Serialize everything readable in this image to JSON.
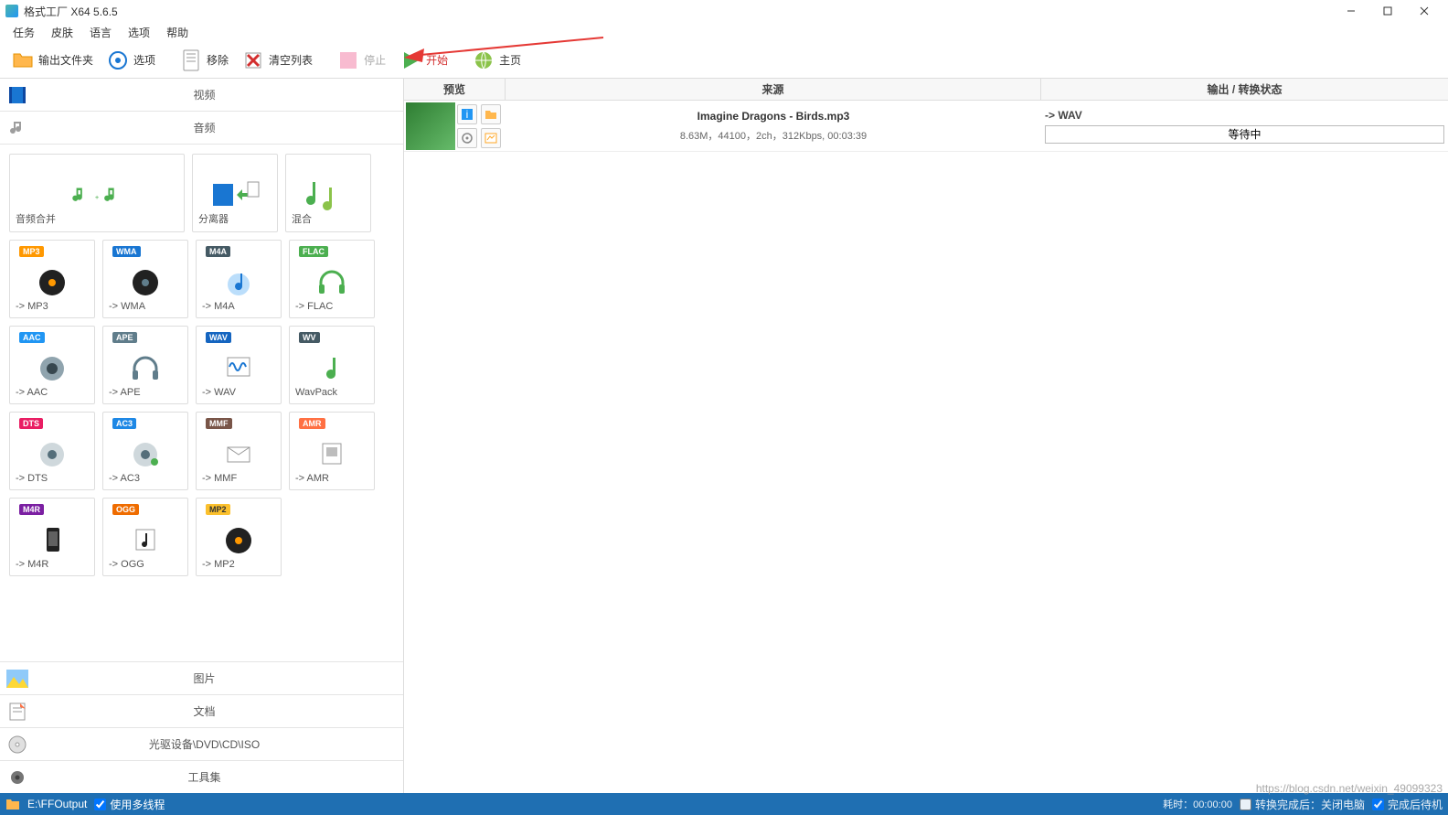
{
  "window": {
    "title": "格式工厂 X64 5.6.5"
  },
  "menu": {
    "tasks": "任务",
    "skin": "皮肤",
    "language": "语言",
    "options": "选项",
    "help": "帮助"
  },
  "toolbar": {
    "output_folder": "输出文件夹",
    "options": "选项",
    "remove": "移除",
    "clear_list": "清空列表",
    "stop": "停止",
    "start": "开始",
    "homepage": "主页"
  },
  "categories": {
    "video": "视频",
    "audio": "音频",
    "picture": "图片",
    "document": "文档",
    "disc": "光驱设备\\DVD\\CD\\ISO",
    "tools": "工具集"
  },
  "tiles": {
    "merge": "音频合并",
    "splitter": "分离器",
    "mix": "混合",
    "mp3": "-> MP3",
    "wma": "-> WMA",
    "m4a": "-> M4A",
    "flac": "-> FLAC",
    "aac": "-> AAC",
    "ape": "-> APE",
    "wav": "-> WAV",
    "wavpack": "WavPack",
    "dts": "-> DTS",
    "ac3": "-> AC3",
    "mmf": "-> MMF",
    "amr": "-> AMR",
    "m4r": "-> M4R",
    "ogg": "-> OGG",
    "mp2": "-> MP2"
  },
  "tile_badges": {
    "mp3": "MP3",
    "wma": "WMA",
    "m4a": "M4A",
    "flac": "FLAC",
    "aac": "AAC",
    "ape": "APE",
    "wav": "WAV",
    "wavpack": "WV",
    "dts": "DTS",
    "ac3": "AC3",
    "mmf": "MMF",
    "amr": "AMR",
    "m4r": "M4R",
    "ogg": "OGG",
    "mp2": "MP2"
  },
  "columns": {
    "preview": "预览",
    "source": "来源",
    "status": "输出 / 转换状态"
  },
  "tasks": [
    {
      "filename": "Imagine Dragons - Birds.mp3",
      "details": "8.63M，44100，2ch，312Kbps, 00:03:39",
      "target": "-> WAV",
      "status": "等待中"
    }
  ],
  "statusbar": {
    "output_path": "E:\\FFOutput",
    "multithread_label": "使用多线程",
    "elapsed": "耗时：00:00:00",
    "after_convert": "转换完成后：关闭电脑",
    "after_complete": "完成后待机"
  },
  "watermark": "https://blog.csdn.net/weixin_49099323"
}
